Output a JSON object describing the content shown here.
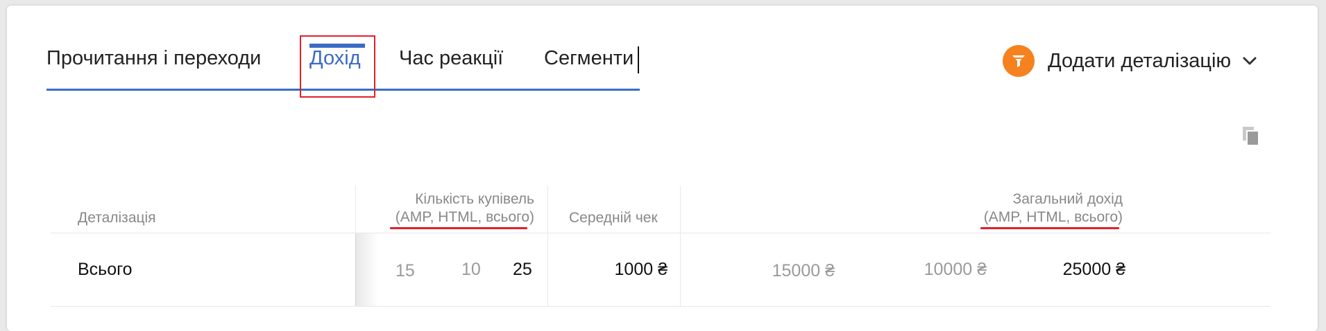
{
  "tabs": [
    {
      "label": "Прочитання і переходи",
      "active": false
    },
    {
      "label": "Дохід",
      "active": true
    },
    {
      "label": "Час реакції",
      "active": false
    },
    {
      "label": "Сегменти",
      "active": false
    }
  ],
  "add_detail": {
    "label": "Додати деталізацію",
    "icon": "funnel-icon",
    "icon_color": "#f5821f"
  },
  "copy_icon": "copy-icon",
  "accent_color": "#3b6bc4",
  "highlight_color": "#e0202a",
  "table": {
    "headers": {
      "detail": "Деталізація",
      "purchases_line1": "Кількість купівель",
      "purchases_line2": "(AMP, HTML, всього)",
      "avg_check": "Середній чек",
      "total_income_line1": "Загальний дохід",
      "total_income_line2": "(AMP, HTML, всього)"
    },
    "rows": [
      {
        "label": "Всього",
        "purchases_amp": "15",
        "purchases_html": "10",
        "purchases_total": "25",
        "avg_check": "1000 ₴",
        "income_amp": "15000 ₴",
        "income_html": "10000 ₴",
        "income_total": "25000 ₴"
      }
    ]
  }
}
